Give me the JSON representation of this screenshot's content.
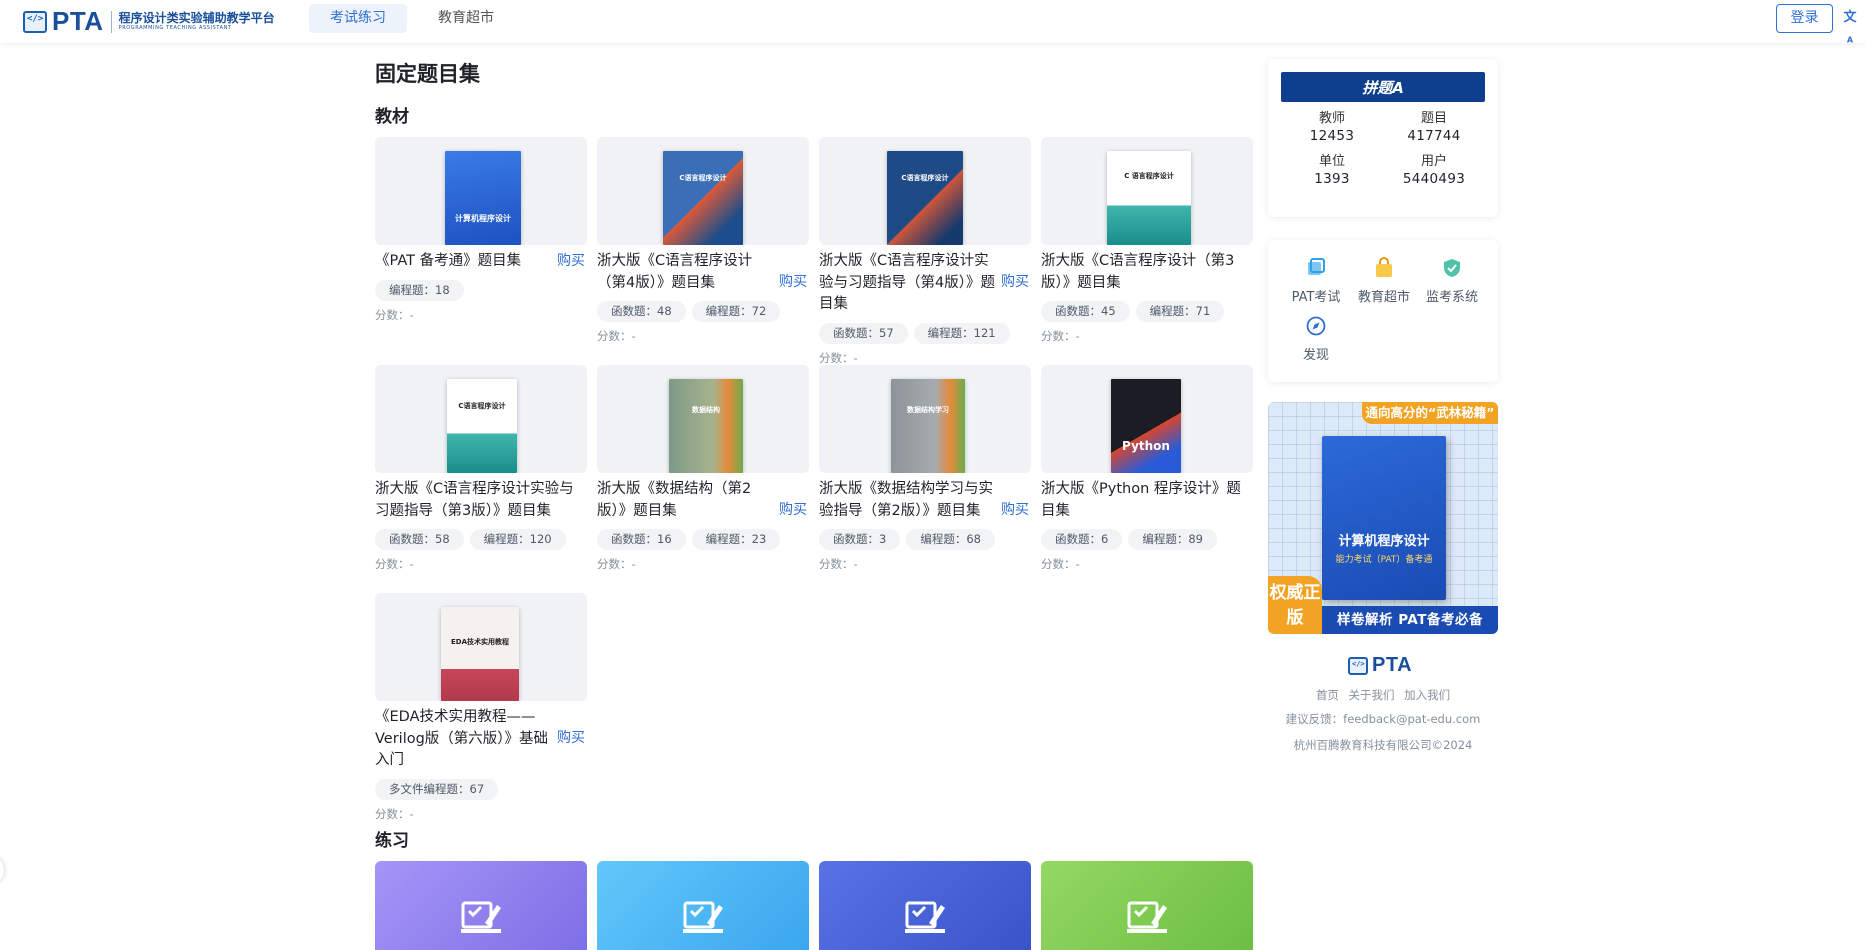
{
  "header": {
    "logo_text": "PTA",
    "logo_cn": "程序设计类实验辅助教学平台",
    "logo_en": "PROGRAMMING TEACHING ASSISTANT",
    "tabs": [
      {
        "label": "考试练习",
        "active": true
      },
      {
        "label": "教育超市",
        "active": false
      }
    ],
    "login_label": "登录",
    "lang_icon": "translate-icon"
  },
  "main": {
    "page_title": "固定题目集",
    "section_textbooks": "教材",
    "section_practice": "练习",
    "textbooks": [
      {
        "title": "《PAT 备考通》题目集",
        "buy": "购买",
        "tags": [
          "编程题：18"
        ],
        "score": "分数：-",
        "cover_title": "计算机程序设计",
        "cover_color": "#2e6bd6"
      },
      {
        "title": "浙大版《C语言程序设计（第4版）》题目集",
        "buy": "购买",
        "tags": [
          "函数题：48",
          "编程题：72"
        ],
        "score": "分数：-",
        "cover_title": "C语言程序设计",
        "cover_color": "#2d5fa8"
      },
      {
        "title": "浙大版《C语言程序设计实验与习题指导（第4版）》题目集",
        "buy": "购买",
        "tags": [
          "函数题：57",
          "编程题：121"
        ],
        "score": "分数：-",
        "cover_title": "C语言程序设计",
        "cover_color": "#1e4a86"
      },
      {
        "title": "浙大版《C语言程序设计（第3版）》题目集",
        "buy": "",
        "tags": [
          "函数题：45",
          "编程题：71"
        ],
        "score": "分数：-",
        "cover_title": "C 语言程序设计",
        "cover_color": "#ffffff"
      },
      {
        "title": "浙大版《C语言程序设计实验与习题指导（第3版）》题目集",
        "buy": "",
        "tags": [
          "函数题：58",
          "编程题：120"
        ],
        "score": "分数：-",
        "cover_title": "C语言程序设计",
        "cover_color": "#ffffff"
      },
      {
        "title": "浙大版《数据结构（第2版）》题目集",
        "buy": "购买",
        "tags": [
          "函数题：16",
          "编程题：23"
        ],
        "score": "分数：-",
        "cover_title": "数据结构",
        "cover_color": "#8ea08a"
      },
      {
        "title": "浙大版《数据结构学习与实验指导（第2版）》题目集",
        "buy": "购买",
        "tags": [
          "函数题：3",
          "编程题：68"
        ],
        "score": "分数：-",
        "cover_title": "数据结构学习",
        "cover_color": "#9aa0a6"
      },
      {
        "title": "浙大版《Python 程序设计》题目集",
        "buy": "",
        "tags": [
          "函数题：6",
          "编程题：89"
        ],
        "score": "分数：-",
        "cover_title": "Python",
        "cover_color": "#1c1c24"
      },
      {
        "title": "《EDA技术实用教程——Verilog版（第六版）》基础入门",
        "buy": "购买",
        "tags": [
          "多文件编程题：67"
        ],
        "score": "分数：-",
        "cover_title": "EDA技术实用教程",
        "cover_color": "#f4f1ee"
      }
    ],
    "practice_colors": [
      "#8c7ef0",
      "#52b8f5",
      "#4a63d9",
      "#7fce52"
    ]
  },
  "sidebar": {
    "banner": "拼题A",
    "stats": [
      {
        "label": "教师",
        "value": "12453"
      },
      {
        "label": "题目",
        "value": "417744"
      },
      {
        "label": "单位",
        "value": "1393"
      },
      {
        "label": "用户",
        "value": "5440493"
      }
    ],
    "links": [
      {
        "label": "PAT考试",
        "icon": "pat-exam-icon",
        "color": "#2f9fe6"
      },
      {
        "label": "教育超市",
        "icon": "shopping-bag-icon",
        "color": "#f0b429"
      },
      {
        "label": "监考系统",
        "icon": "shield-icon",
        "color": "#1fa38a"
      },
      {
        "label": "发现",
        "icon": "compass-icon",
        "color": "#2f6fd6"
      }
    ],
    "ad": {
      "top": "通向高分的“武林秘籍”",
      "book_title": "计算机程序设计",
      "book_sub": "能力考试（PAT）备考通",
      "badge": "权威正版",
      "bottom": "样卷解析  PAT备考必备"
    },
    "footer": {
      "logo": "PTA",
      "links": [
        "首页",
        "关于我们",
        "加入我们"
      ],
      "feedback": "建议反馈：feedback@pat-edu.com",
      "company": "杭州百腾教育科技有限公司©2024"
    }
  }
}
